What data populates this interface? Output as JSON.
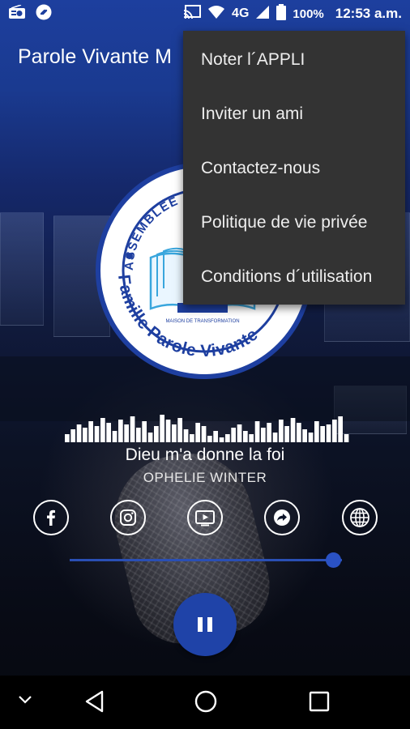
{
  "status_bar": {
    "battery_percent": "100%",
    "time": "12:53 a.m.",
    "network": "4G",
    "icons": [
      "radio-icon",
      "shazam-icon",
      "cast-icon",
      "wifi-icon",
      "signal-icon",
      "battery-icon"
    ]
  },
  "app": {
    "title": "Parole Vivante M"
  },
  "menu": {
    "items": [
      {
        "label": "Noter l´APPLI"
      },
      {
        "label": "Inviter un ami"
      },
      {
        "label": "Contactez-nous"
      },
      {
        "label": "Politique de vie privée"
      },
      {
        "label": "Conditions d´utilisation"
      }
    ]
  },
  "logo": {
    "arc_text_top": "ASSEMBLÉE",
    "arc_text_bottom": "Famille Parole Vivante",
    "caption": "MAISON DE TRANSFORMATION"
  },
  "player": {
    "track_title": "Dieu m'a donne la foi",
    "artist": "OPHELIE WINTER",
    "volume_fraction": 0.97,
    "state": "playing"
  },
  "social": {
    "icons": [
      "facebook-icon",
      "instagram-icon",
      "youtube-icon",
      "share-icon",
      "globe-icon"
    ]
  },
  "nav_bar": {
    "icons": [
      "chevron-down-icon",
      "back-icon",
      "home-icon",
      "recents-icon"
    ]
  },
  "colors": {
    "brand_blue": "#1f43a8",
    "menu_bg": "#333333",
    "slider": "#2a4fb4"
  }
}
